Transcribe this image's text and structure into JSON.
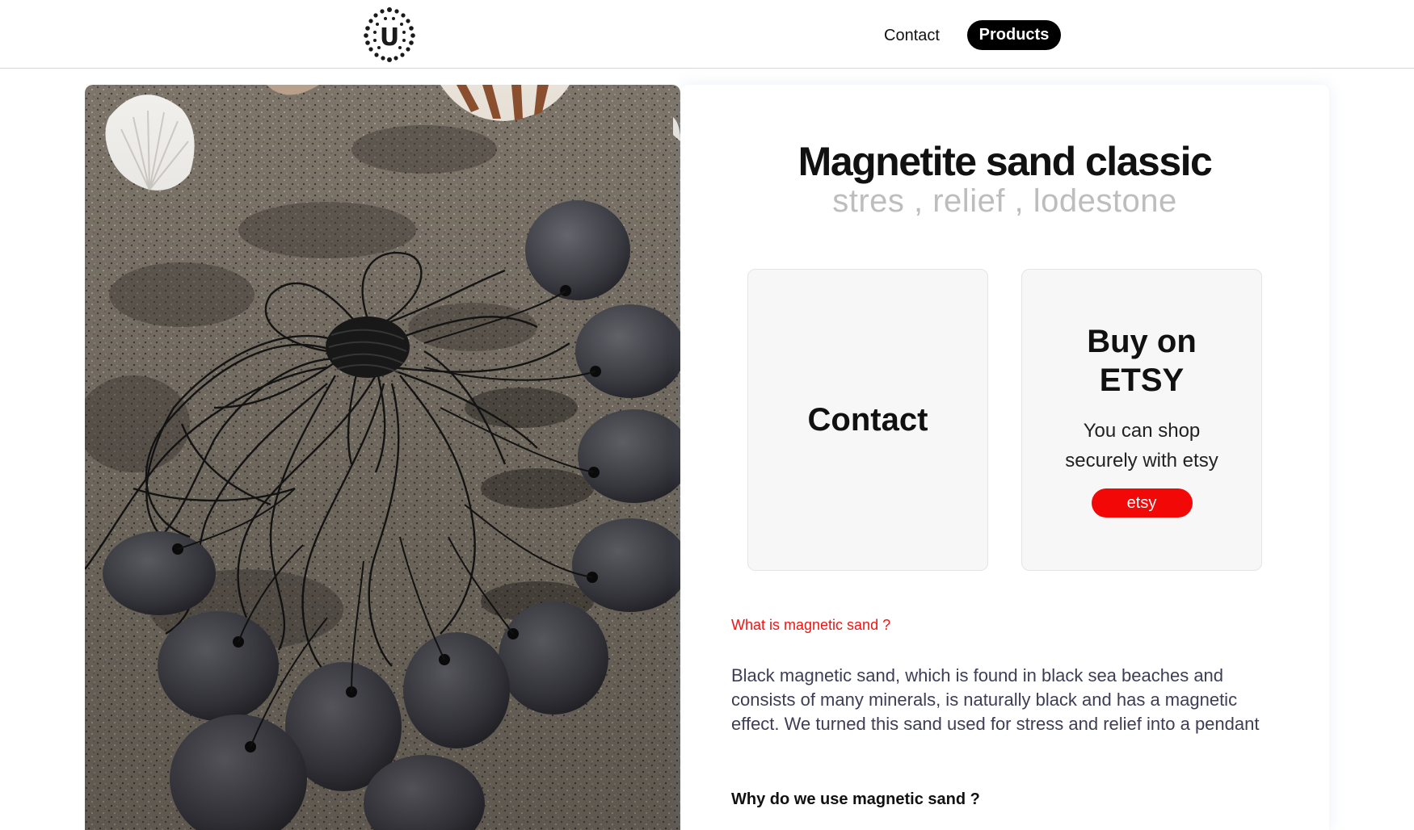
{
  "header": {
    "logo_letter": "U",
    "nav": {
      "contact": "Contact",
      "products": "Products"
    }
  },
  "product": {
    "title": "Magnetite sand classic",
    "tags": "stres , relief , lodestone",
    "image_subject": "magnetite sand pendants with black cords on beach sand"
  },
  "cards": {
    "contact": {
      "title": "Contact"
    },
    "etsy": {
      "title": "Buy on ETSY",
      "text": "You can shop securely with etsy",
      "button": "etsy"
    }
  },
  "article": {
    "q1": "What is magnetic sand ?",
    "p1": "Black magnetic sand, which is found in black sea beaches and consists of many minerals, is naturally black and has a magnetic effect. We turned this sand used for stress and relief into a pendant",
    "q2": "Why do we use magnetic sand ?"
  },
  "colors": {
    "accent_red": "#f30808",
    "nav_active": "#000000",
    "subtitle_gray": "#bdbdbd"
  }
}
